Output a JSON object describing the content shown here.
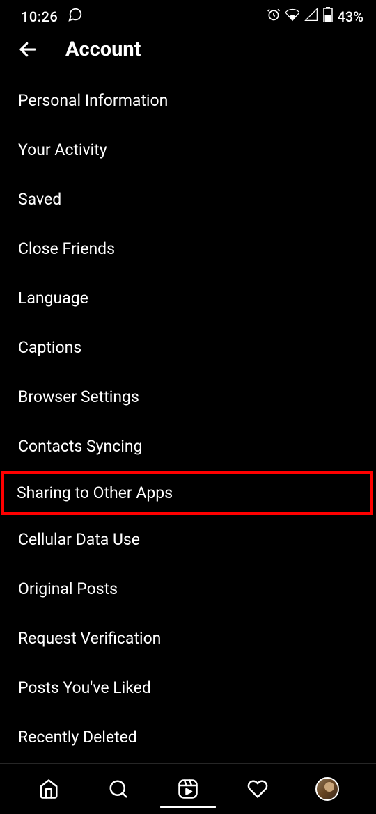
{
  "status_bar": {
    "time": "10:26",
    "battery_pct": "43%"
  },
  "header": {
    "title": "Account"
  },
  "menu": {
    "items": [
      {
        "label": "Personal Information",
        "highlighted": false
      },
      {
        "label": "Your Activity",
        "highlighted": false
      },
      {
        "label": "Saved",
        "highlighted": false
      },
      {
        "label": "Close Friends",
        "highlighted": false
      },
      {
        "label": "Language",
        "highlighted": false
      },
      {
        "label": "Captions",
        "highlighted": false
      },
      {
        "label": "Browser Settings",
        "highlighted": false
      },
      {
        "label": "Contacts Syncing",
        "highlighted": false
      },
      {
        "label": "Sharing to Other Apps",
        "highlighted": true
      },
      {
        "label": "Cellular Data Use",
        "highlighted": false
      },
      {
        "label": "Original Posts",
        "highlighted": false
      },
      {
        "label": "Request Verification",
        "highlighted": false
      },
      {
        "label": "Posts You've Liked",
        "highlighted": false
      },
      {
        "label": "Recently Deleted",
        "highlighted": false
      }
    ]
  }
}
